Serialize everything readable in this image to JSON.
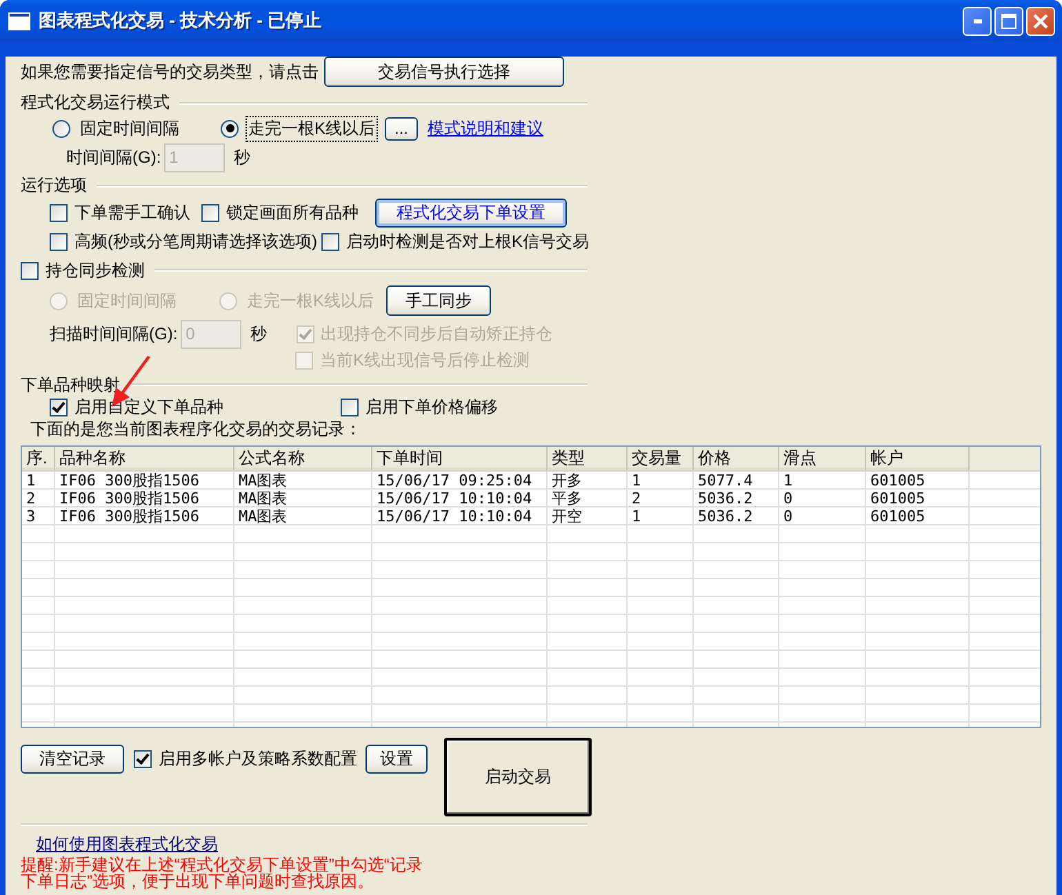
{
  "window": {
    "title": "图表程式化交易 - 技术分析 - 已停止"
  },
  "signal_type": {
    "prompt": "如果您需要指定信号的交易类型，请点击",
    "button": "交易信号执行选择"
  },
  "run_mode": {
    "heading": "程式化交易运行模式",
    "radios": [
      {
        "label": "固定时间间隔",
        "selected": false,
        "disabled": false
      },
      {
        "label": "走完一根K线以后",
        "selected": true,
        "disabled": false
      }
    ],
    "more_button": "...",
    "help_link": "模式说明和建议",
    "interval_label": "时间间隔(G):",
    "interval_value": "1",
    "interval_unit": "秒",
    "interval_disabled": true
  },
  "run_options": {
    "heading": "运行选项",
    "checkboxes": [
      {
        "label": "下单需手工确认",
        "checked": false,
        "disabled": false
      },
      {
        "label": "锁定画面所有品种",
        "checked": false,
        "disabled": false
      },
      {
        "label": "高频(秒或分笔周期请选择该选项)",
        "checked": false,
        "disabled": false
      },
      {
        "label": "启动时检测是否对上根K信号交易",
        "checked": false,
        "disabled": false
      }
    ],
    "order_settings_button": "程式化交易下单设置"
  },
  "position_sync": {
    "label": "持仓同步检测",
    "checked": false,
    "radios": [
      {
        "label": "固定时间间隔",
        "selected": false,
        "disabled": true
      },
      {
        "label": "走完一根K线以后",
        "selected": false,
        "disabled": true
      }
    ],
    "sync_button": "手工同步",
    "scan_label": "扫描时间间隔(G):",
    "scan_value": "0",
    "scan_unit": "秒",
    "scan_disabled": true,
    "checkboxes": [
      {
        "label": "出现持仓不同步后自动矫正持仓",
        "checked": true,
        "disabled": true
      },
      {
        "label": "当前K线出现信号后停止检测",
        "checked": false,
        "disabled": true
      }
    ]
  },
  "symbol_mapping": {
    "heading": "下单品种映射",
    "checkboxes": [
      {
        "label": "启用自定义下单品种",
        "checked": true,
        "disabled": false
      },
      {
        "label": "启用下单价格偏移",
        "checked": false,
        "disabled": false
      }
    ]
  },
  "records": {
    "caption": "下面的是您当前图表程序化交易的交易记录：",
    "columns": [
      "序.",
      "品种名称",
      "公式名称",
      "下单时间",
      "类型",
      "交易量",
      "价格",
      "滑点",
      "帐户"
    ],
    "rows": [
      [
        "1",
        "IF06 300股指1506",
        "MA图表",
        "15/06/17 09:25:04",
        "开多",
        "1",
        "5077.4",
        "1",
        "601005"
      ],
      [
        "2",
        "IF06 300股指1506",
        "MA图表",
        "15/06/17 10:10:04",
        "平多",
        "2",
        "5036.2",
        "0",
        "601005"
      ],
      [
        "3",
        "IF06 300股指1506",
        "MA图表",
        "15/06/17 10:10:04",
        "开空",
        "1",
        "5036.2",
        "0",
        "601005"
      ]
    ]
  },
  "bottom": {
    "clear_button": "清空记录",
    "multi_account": {
      "label": "启用多帐户及策略系数配置",
      "checked": true,
      "disabled": false
    },
    "settings_button": "设置",
    "start_button": "启动交易"
  },
  "help_link": "如何使用图表程式化交易",
  "reminder": "提醒:新手建议在上述“程式化交易下单设置”中勾选“记录下单日志”选项，便于出现下单问题时查找原因。"
}
